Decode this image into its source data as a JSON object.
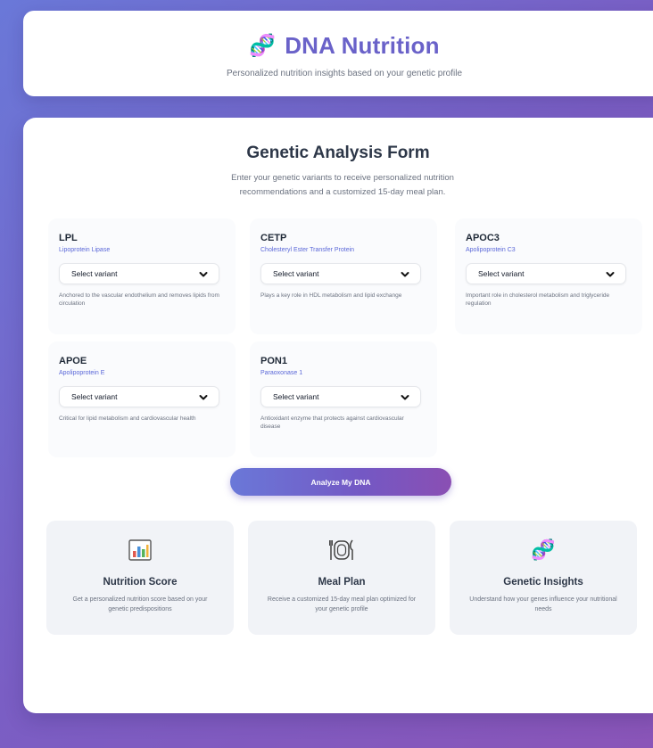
{
  "header": {
    "icon": "dna-icon",
    "title": "DNA Nutrition",
    "tagline": "Personalized nutrition insights based on your genetic profile"
  },
  "form": {
    "title": "Genetic Analysis Form",
    "description": "Enter your genetic variants to receive personalized nutrition recommendations and a customized 15-day meal plan.",
    "genes": [
      {
        "symbol": "LPL",
        "name": "Lipoprotein Lipase",
        "select_value": "Select variant",
        "description": "Anchored to the vascular endothelium and removes lipids from circulation"
      },
      {
        "symbol": "CETP",
        "name": "Cholesteryl Ester Transfer Protein",
        "select_value": "Select variant",
        "description": "Plays a key role in HDL metabolism and lipid exchange"
      },
      {
        "symbol": "APOC3",
        "name": "Apolipoprotein C3",
        "select_value": "Select variant",
        "description": "Important role in cholesterol metabolism and triglyceride regulation"
      },
      {
        "symbol": "APOE",
        "name": "Apolipoprotein E",
        "select_value": "Select variant",
        "description": "Critical for lipid metabolism and cardiovascular health"
      },
      {
        "symbol": "PON1",
        "name": "Paraoxonase 1",
        "select_value": "Select variant",
        "description": "Antioxidant enzyme that protects against cardiovascular disease"
      }
    ],
    "submit_label": "Analyze My DNA"
  },
  "features": [
    {
      "icon": "bar-chart-icon",
      "title": "Nutrition Score",
      "description": "Get a personalized nutrition score based on your genetic predispositions"
    },
    {
      "icon": "plate-cutlery-icon",
      "title": "Meal Plan",
      "description": "Receive a customized 15-day meal plan optimized for your genetic profile"
    },
    {
      "icon": "dna-icon",
      "title": "Genetic Insights",
      "description": "Understand how your genes influence your nutritional needs"
    }
  ],
  "colors": {
    "accent": "#6a62c9",
    "gradient_start": "#6a78d8",
    "gradient_end": "#8a55b8",
    "link_blue": "#5a67d8"
  }
}
